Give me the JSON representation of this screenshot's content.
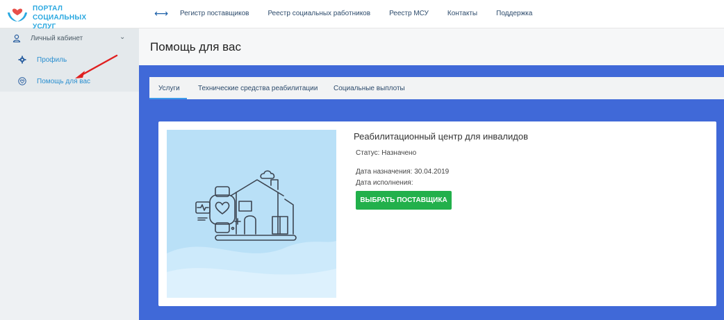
{
  "logo": {
    "line1": "ПОРТАЛ",
    "line2": "СОЦИАЛЬНЫХ УСЛУГ"
  },
  "nav": {
    "toggle_icon": "left-right-arrows-icon",
    "items": [
      {
        "label": "Регистр поставщиков"
      },
      {
        "label": "Реестр социальных работников"
      },
      {
        "label": "Реестр МСУ"
      },
      {
        "label": "Контакты"
      },
      {
        "label": "Поддержка"
      }
    ]
  },
  "sidebar": {
    "section": {
      "label": "Личный кабинет",
      "icon": "user-icon"
    },
    "items": [
      {
        "label": "Профиль",
        "icon": "gear-icon"
      },
      {
        "label": "Помощь для вас",
        "icon": "heart-icon"
      }
    ]
  },
  "page": {
    "title": "Помощь для вас"
  },
  "tabs": [
    {
      "label": "Услуги",
      "active": true
    },
    {
      "label": "Технические средства реабилитации",
      "active": false
    },
    {
      "label": "Социальные выплоты",
      "active": false
    }
  ],
  "service": {
    "title": "Реабилитационный центр для инвалидов",
    "status": "Статус: Назначено",
    "assigned": "Дата назначения: 30.04.2019",
    "executed": "Дата исполнения:",
    "button": "ВЫБРАТЬ ПОСТАВЩИКА"
  },
  "colors": {
    "accent_blue": "#4069d8",
    "button_green": "#22b04b",
    "link_blue": "#2a8fd0",
    "arrow_red": "#e02020"
  }
}
